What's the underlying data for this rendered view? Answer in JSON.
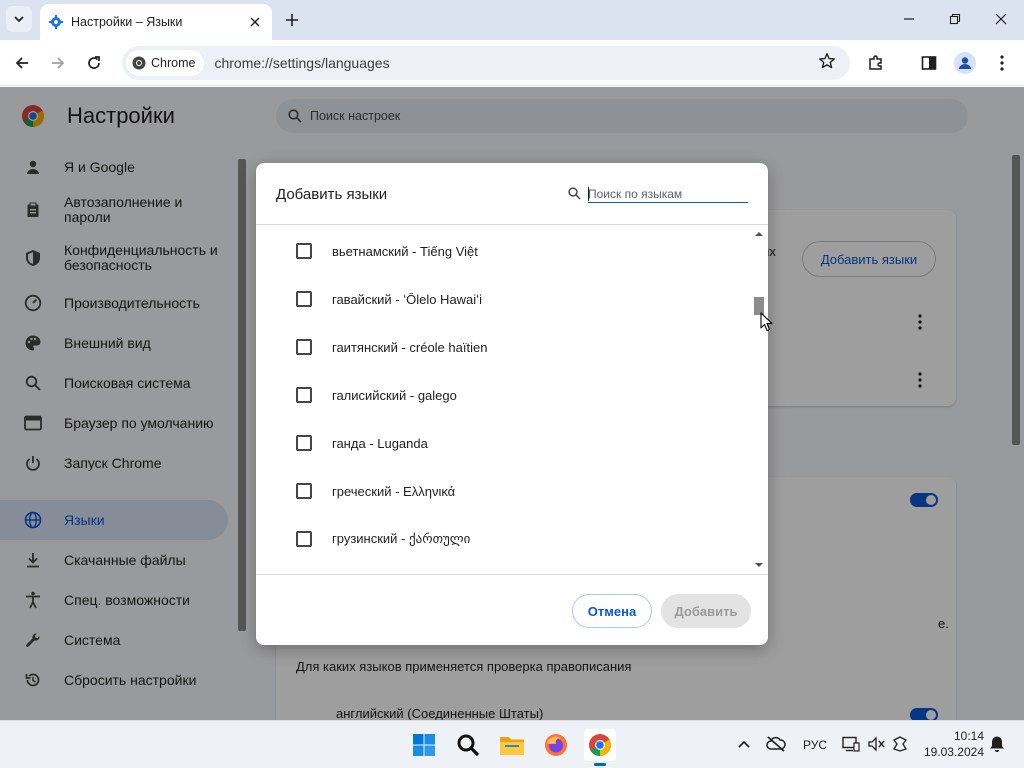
{
  "browser": {
    "tab_title": "Настройки – Языки",
    "chip_label": "Chrome",
    "url": "chrome://settings/languages"
  },
  "settings": {
    "title": "Настройки",
    "search_placeholder": "Поиск настроек",
    "nav": [
      {
        "label": "Я и Google",
        "icon": "person-icon"
      },
      {
        "label": "Автозаполнение и пароли",
        "icon": "clipboard-icon"
      },
      {
        "label": "Конфиденциальность и безопасность",
        "icon": "shield-icon"
      },
      {
        "label": "Производительность",
        "icon": "speedometer-icon"
      },
      {
        "label": "Внешний вид",
        "icon": "palette-icon"
      },
      {
        "label": "Поисковая система",
        "icon": "search-icon"
      },
      {
        "label": "Браузер по умолчанию",
        "icon": "browser-window-icon"
      },
      {
        "label": "Запуск Chrome",
        "icon": "power-icon"
      },
      {
        "label": "Языки",
        "icon": "globe-icon",
        "active": true
      },
      {
        "label": "Скачанные файлы",
        "icon": "download-icon"
      },
      {
        "label": "Спец. возможности",
        "icon": "accessibility-icon"
      },
      {
        "label": "Система",
        "icon": "wrench-icon"
      },
      {
        "label": "Сбросить настройки",
        "icon": "reset-icon"
      }
    ],
    "add_languages_button": "Добавить языки",
    "partial_text_1": "ых",
    "partial_text_2": "е.",
    "spellcheck_heading": "Для каких языков применяется проверка правописания",
    "spellcheck_language": "английский (Соединенные Штаты)"
  },
  "dialog": {
    "title": "Добавить языки",
    "search_placeholder": "Поиск по языкам",
    "languages": [
      {
        "label": "вьетнамский - Tiếng Việt",
        "checked": false
      },
      {
        "label": "гавайский - ʻŌlelo Hawaiʻi",
        "checked": false
      },
      {
        "label": "гаитянский - créole haïtien",
        "checked": false
      },
      {
        "label": "галисийский - galego",
        "checked": false
      },
      {
        "label": "ганда - Luganda",
        "checked": false
      },
      {
        "label": "греческий - Ελληνικά",
        "checked": false
      },
      {
        "label": "грузинский - ქართული",
        "checked": false
      }
    ],
    "cancel_label": "Отмена",
    "add_label": "Добавить"
  },
  "taskbar": {
    "language": "РУС",
    "time": "10:14",
    "date": "19.03.2024"
  },
  "colors": {
    "accent": "#0b57d0",
    "scrim": "rgba(0,0,0,0.38)",
    "tabstrip": "#dbe3f1"
  }
}
